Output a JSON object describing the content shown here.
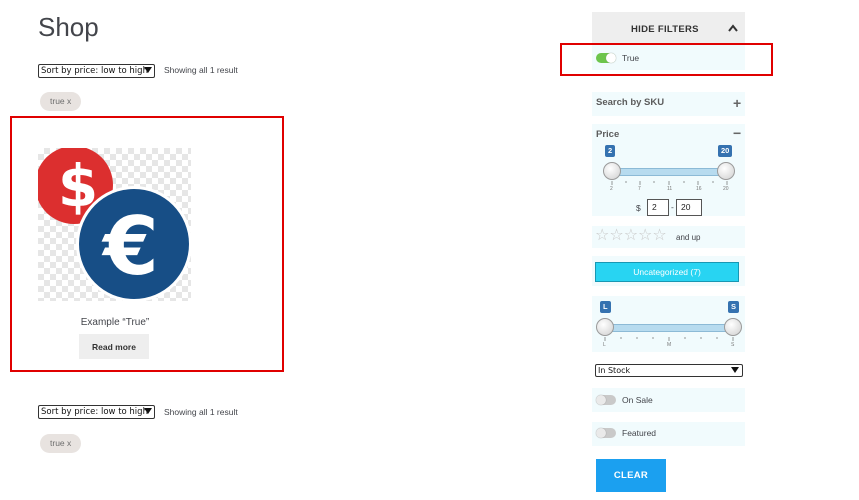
{
  "page": {
    "title": "Shop"
  },
  "sorting": {
    "selected": "Sort by price: low to high",
    "result_count": "Showing all 1 result"
  },
  "active_filter_chip": "true x",
  "product": {
    "title": "Example “True”",
    "button": "Read more"
  },
  "filters": {
    "hide_label": "HIDE FILTERS",
    "attribute_toggle": {
      "label": "True",
      "on": true
    },
    "sku": {
      "title": "Search by SKU"
    },
    "price": {
      "title": "Price",
      "min": 2,
      "max": 20,
      "min_label": "2",
      "max_label": "20",
      "ticks": [
        "2",
        "7",
        "11",
        "16",
        "20"
      ],
      "currency": "$",
      "from": "2",
      "to": "20"
    },
    "rating": {
      "label": "and up",
      "stars": 5
    },
    "category": {
      "label": "Uncategorized (7)"
    },
    "size": {
      "min_label": "L",
      "max_label": "S",
      "ticks": [
        "L",
        "M",
        "S"
      ]
    },
    "stock": {
      "selected": "In Stock"
    },
    "on_sale": {
      "label": "On Sale",
      "on": false
    },
    "featured": {
      "label": "Featured",
      "on": false
    },
    "clear_label": "CLEAR"
  },
  "colors": {
    "accent": "#1ba0f0",
    "category_button": "#28d4f2",
    "toggle_on": "#6dc54c",
    "highlight": "#e00000",
    "dollar_coin": "#dc2f2f",
    "euro_coin": "#174e86"
  },
  "icons": [
    "chevron-up-icon",
    "plus-icon",
    "minus-icon",
    "star-icon",
    "dollar-coin-icon",
    "euro-coin-icon"
  ]
}
